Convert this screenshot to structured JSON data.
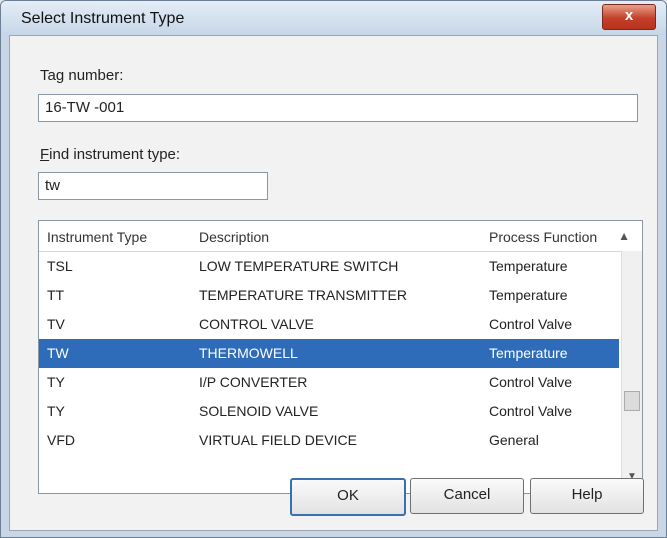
{
  "window": {
    "title": "Select Instrument Type",
    "close_glyph": "x"
  },
  "tag": {
    "label": "Tag number:",
    "value": "16-TW -001"
  },
  "find": {
    "label_first": "F",
    "label_rest": "ind instrument type:",
    "value": "tw"
  },
  "list": {
    "columns": [
      "Instrument Type",
      "Description",
      "Process Function"
    ],
    "sort_icon": "▲",
    "rows": [
      [
        "TSL",
        "LOW TEMPERATURE SWITCH",
        "Temperature"
      ],
      [
        "TT",
        "TEMPERATURE TRANSMITTER",
        "Temperature"
      ],
      [
        "TV",
        "CONTROL VALVE",
        "Control Valve"
      ],
      [
        "TW",
        "THERMOWELL",
        "Temperature"
      ],
      [
        "TY",
        "I/P CONVERTER",
        "Control Valve"
      ],
      [
        "TY",
        "SOLENOID VALVE",
        "Control Valve"
      ],
      [
        "VFD",
        "VIRTUAL FIELD DEVICE",
        "General"
      ]
    ],
    "selected_index": 3
  },
  "buttons": {
    "ok": "OK",
    "cancel": "Cancel",
    "help": "Help"
  }
}
